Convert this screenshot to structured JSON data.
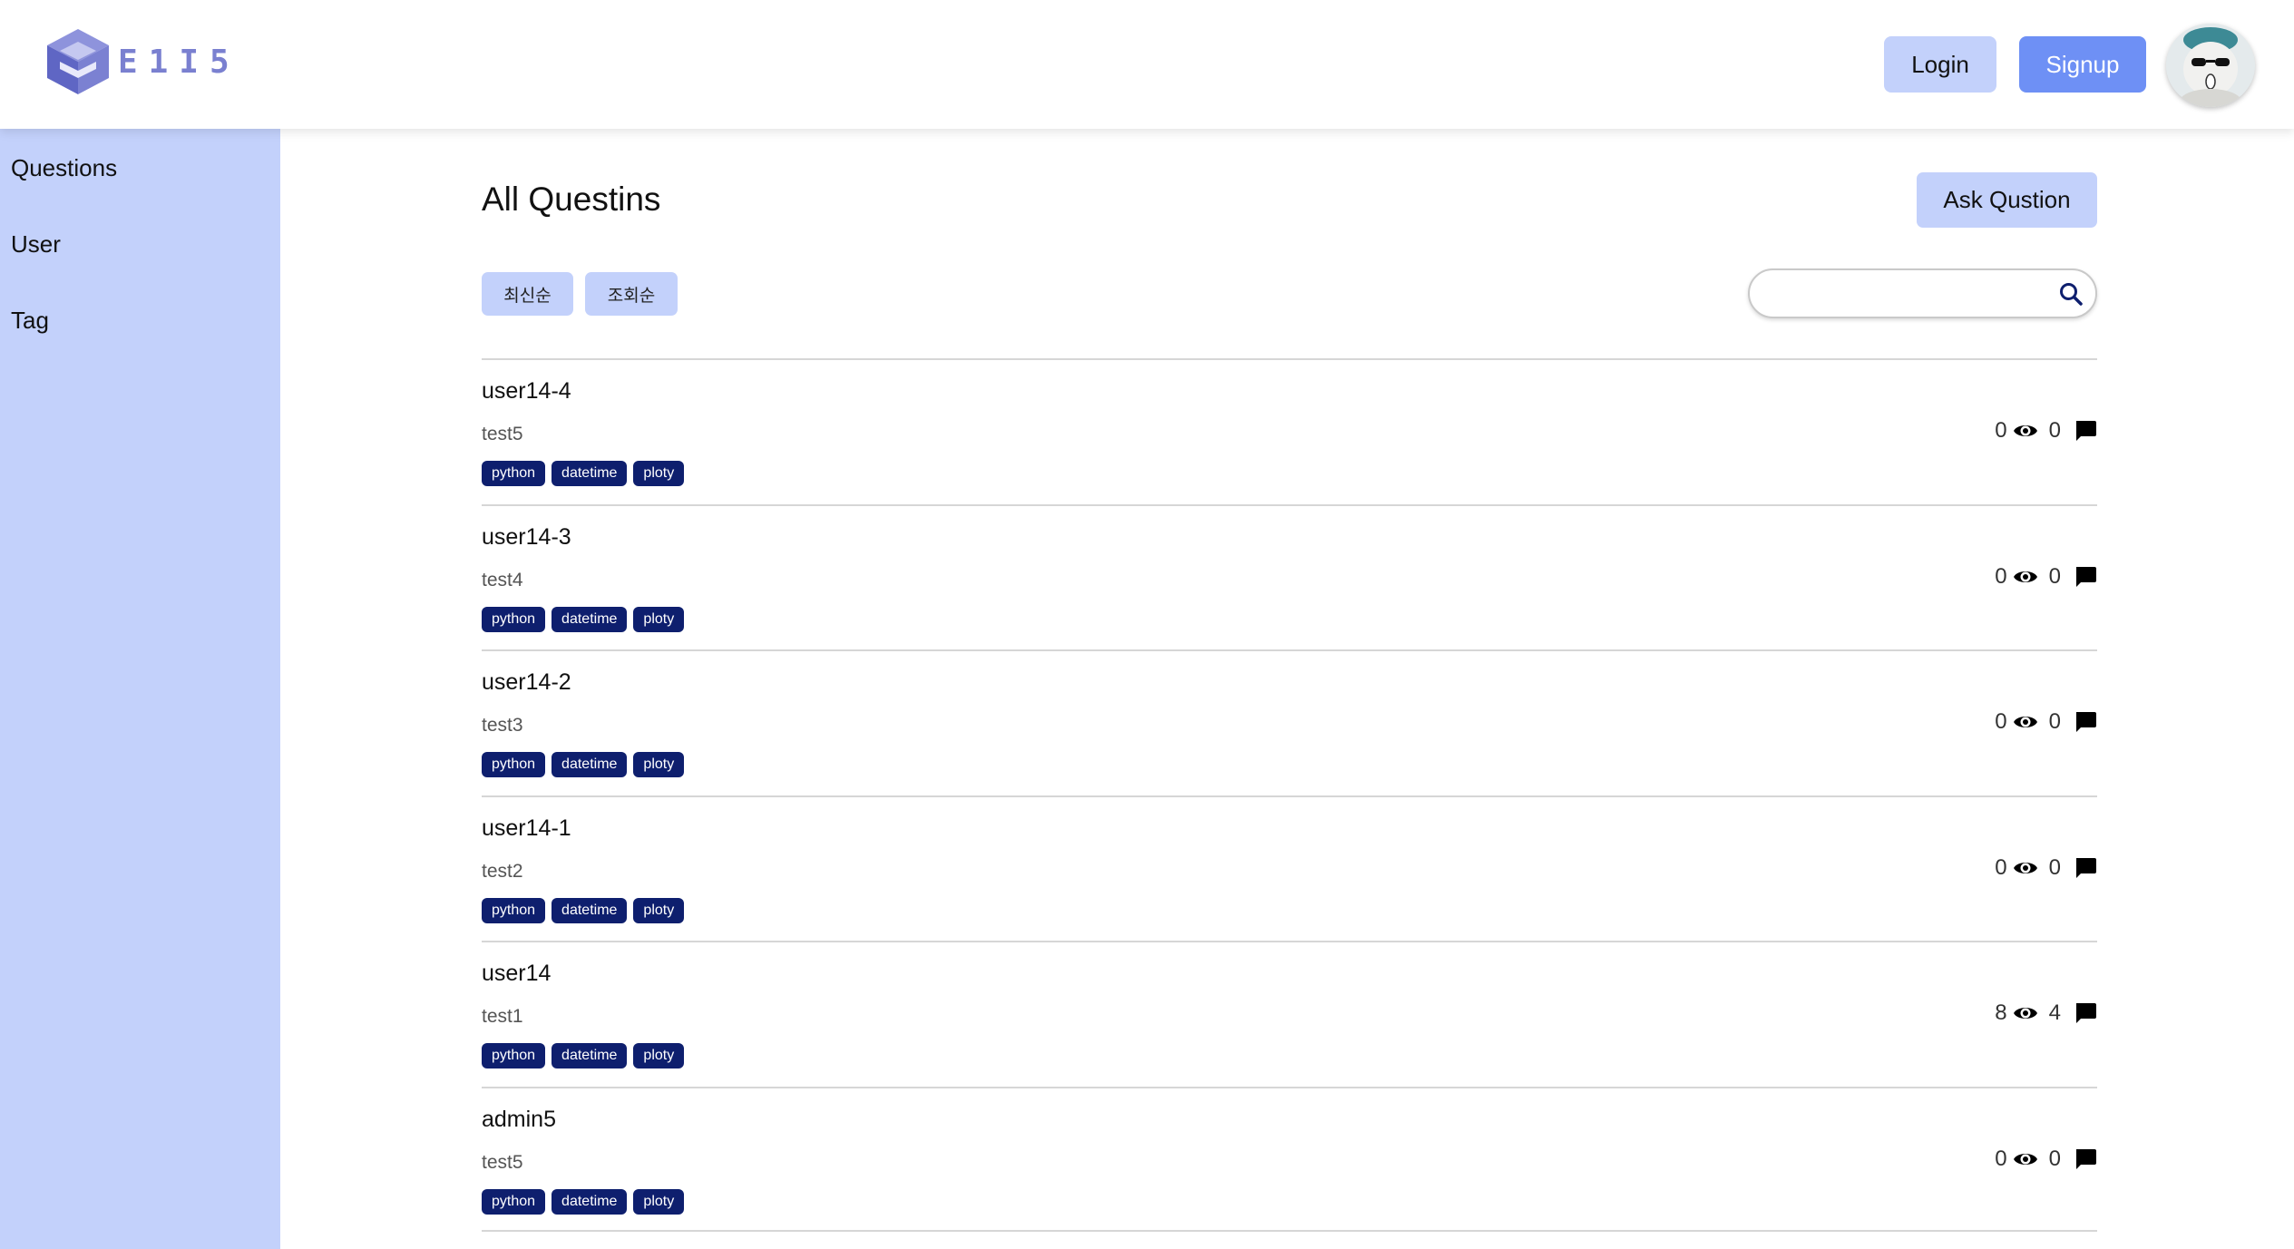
{
  "header": {
    "logo_text": "E1I5",
    "login_label": "Login",
    "signup_label": "Signup"
  },
  "sidebar": {
    "items": [
      {
        "label": "Questions"
      },
      {
        "label": "User"
      },
      {
        "label": "Tag"
      }
    ]
  },
  "main": {
    "title": "All Questins",
    "ask_label": "Ask Qustion",
    "sort_buttons": [
      {
        "label": "최신순"
      },
      {
        "label": "조회순"
      }
    ],
    "search": {
      "value": "",
      "placeholder": ""
    },
    "questions": [
      {
        "title": "user14-4",
        "body": "test5",
        "tags": [
          "python",
          "datetime",
          "ploty"
        ],
        "views": "0",
        "comments": "0"
      },
      {
        "title": "user14-3",
        "body": "test4",
        "tags": [
          "python",
          "datetime",
          "ploty"
        ],
        "views": "0",
        "comments": "0"
      },
      {
        "title": "user14-2",
        "body": "test3",
        "tags": [
          "python",
          "datetime",
          "ploty"
        ],
        "views": "0",
        "comments": "0"
      },
      {
        "title": "user14-1",
        "body": "test2",
        "tags": [
          "python",
          "datetime",
          "ploty"
        ],
        "views": "0",
        "comments": "0"
      },
      {
        "title": "user14",
        "body": "test1",
        "tags": [
          "python",
          "datetime",
          "ploty"
        ],
        "views": "8",
        "comments": "4"
      },
      {
        "title": "admin5",
        "body": "test5",
        "tags": [
          "python",
          "datetime",
          "ploty"
        ],
        "views": "0",
        "comments": "0"
      }
    ]
  },
  "colors": {
    "sidebar_bg": "#c3d1fb",
    "signup_bg": "#6e90f5",
    "tag_bg": "#0e1f6e",
    "logo": "#7a80d0"
  },
  "icons": {
    "view": "eye-icon",
    "comment": "chat-bubble-icon",
    "search": "search-icon"
  }
}
